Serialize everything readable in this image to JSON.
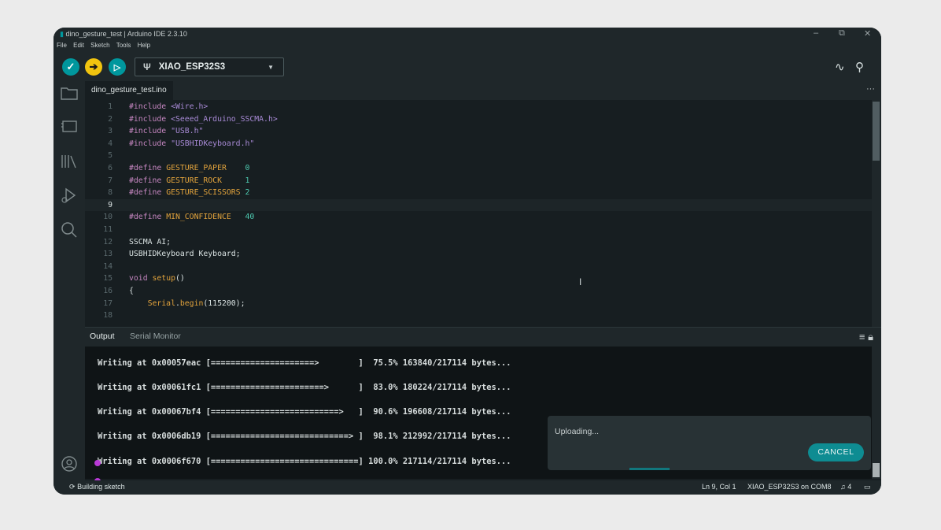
{
  "window": {
    "title": "dino_gesture_test | Arduino IDE 2.3.10",
    "menu": [
      "File",
      "Edit",
      "Sketch",
      "Tools",
      "Help"
    ],
    "controls": {
      "minimize": "–",
      "restore": "⧉",
      "close": "✕"
    }
  },
  "toolbar": {
    "verify_icon": "checkmark-icon",
    "upload_icon": "arrow-right-icon",
    "debug_icon": "debug-icon",
    "board_icon": "usb-icon",
    "board": "XIAO_ESP32S3",
    "serial_plotter_icon": "plotter-icon",
    "serial_monitor_icon": "magnifier-icon",
    "colors": {
      "verify": "#00979d",
      "upload": "#f1c40f",
      "debug": "#00979d"
    }
  },
  "sidebar": {
    "items": [
      {
        "icon": "folder-icon"
      },
      {
        "icon": "board-manager-icon"
      },
      {
        "icon": "library-icon"
      },
      {
        "icon": "debug-icon"
      },
      {
        "icon": "search-icon"
      }
    ],
    "profile_icon": "profile-icon"
  },
  "editor": {
    "tab": "dino_gesture_test.ino",
    "more": "···",
    "current_line": 9,
    "lines": [
      {
        "n": "1",
        "segs": [
          [
            "#include ",
            "kw"
          ],
          [
            "<Wire.h>",
            "str"
          ]
        ]
      },
      {
        "n": "2",
        "segs": [
          [
            "#include ",
            "kw"
          ],
          [
            "<Seeed_Arduino_SSCMA.h>",
            "str"
          ]
        ]
      },
      {
        "n": "3",
        "segs": [
          [
            "#include ",
            "kw"
          ],
          [
            "\"USB.h\"",
            "str"
          ]
        ]
      },
      {
        "n": "4",
        "segs": [
          [
            "#include ",
            "kw"
          ],
          [
            "\"USBHIDKeyboard.h\"",
            "str"
          ]
        ]
      },
      {
        "n": "5",
        "segs": []
      },
      {
        "n": "6",
        "segs": [
          [
            "#define ",
            "kw"
          ],
          [
            "GESTURE_PAPER",
            "def"
          ],
          [
            "    ",
            "plain"
          ],
          [
            "0",
            "num"
          ]
        ]
      },
      {
        "n": "7",
        "segs": [
          [
            "#define ",
            "kw"
          ],
          [
            "GESTURE_ROCK",
            "def"
          ],
          [
            "     ",
            "plain"
          ],
          [
            "1",
            "num"
          ]
        ]
      },
      {
        "n": "8",
        "segs": [
          [
            "#define ",
            "kw"
          ],
          [
            "GESTURE_SCISSORS",
            "def"
          ],
          [
            " ",
            "plain"
          ],
          [
            "2",
            "num"
          ]
        ]
      },
      {
        "n": "9",
        "segs": []
      },
      {
        "n": "10",
        "segs": [
          [
            "#define ",
            "kw"
          ],
          [
            "MIN_CONFIDENCE",
            "def"
          ],
          [
            "   ",
            "plain"
          ],
          [
            "40",
            "num"
          ]
        ]
      },
      {
        "n": "11",
        "segs": []
      },
      {
        "n": "12",
        "segs": [
          [
            "SSCMA AI;",
            "plain"
          ]
        ]
      },
      {
        "n": "13",
        "segs": [
          [
            "USBHIDKeyboard Keyboard;",
            "plain"
          ]
        ]
      },
      {
        "n": "14",
        "segs": []
      },
      {
        "n": "15",
        "segs": [
          [
            "void ",
            "kw"
          ],
          [
            "setup",
            "fn"
          ],
          [
            "()",
            "plain"
          ]
        ]
      },
      {
        "n": "16",
        "segs": [
          [
            "{",
            "plain"
          ]
        ]
      },
      {
        "n": "17",
        "segs": [
          [
            "    ",
            "plain"
          ],
          [
            "Serial",
            "fn"
          ],
          [
            ".",
            "plain"
          ],
          [
            "begin",
            "fn"
          ],
          [
            "(115200);",
            "plain"
          ]
        ]
      },
      {
        "n": "18",
        "segs": []
      }
    ],
    "colors": {
      "kw": "#c586c0",
      "str": "#a88ad6",
      "def": "#e2a33c",
      "num": "#4ec9b0",
      "fn": "#e2a33c",
      "plain": "#dae3e3"
    }
  },
  "panel": {
    "tabs": [
      "Output",
      "Serial Monitor"
    ],
    "icons": [
      "list-icon",
      "lock-icon"
    ],
    "output_lines": [
      "Writing at 0x00057eac [=====================>        ]  75.5% 163840/217114 bytes...",
      "Writing at 0x00061fc1 [=======================>      ]  83.0% 180224/217114 bytes...",
      "Writing at 0x00067bf4 [==========================>   ]  90.6% 196608/217114 bytes...",
      "Writing at 0x0006db19 [============================> ]  98.1% 212992/217114 bytes...",
      "Writing at 0x0006f670 [==============================] 100.0% 217114/217114 bytes..."
    ]
  },
  "toast": {
    "message": "Uploading...",
    "cancel": "CANCEL",
    "progress": 0.12
  },
  "status": {
    "left": "Building sketch",
    "position": "Ln 9, Col 1",
    "board": "XIAO_ESP32S3 on COM8",
    "notifications": "4"
  }
}
